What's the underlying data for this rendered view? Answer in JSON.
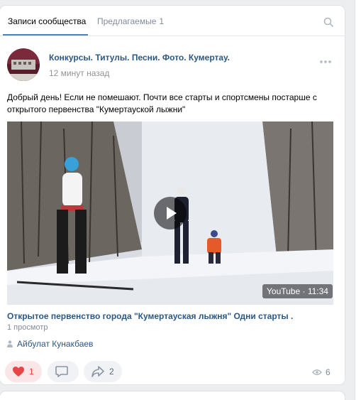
{
  "tabs": {
    "active_label": "Записи сообщества",
    "second_label": "Предлагаемые",
    "second_count": "1"
  },
  "post": {
    "author": "Конкурсы. Титулы. Песни. Фото. Кумертау.",
    "time": "12 минут назад",
    "text": "Добрый день! Если не помешают. Почти все старты и спортсмены постарше с открытого первенства \"Кумертауской лыжни\"",
    "video": {
      "duration": "YouTube · 11:34",
      "title": "Открытое первенство города \"Кумертауская лыжня\" Одни старты .",
      "views_line": "1 просмотр"
    },
    "signer": "Айбулат Кунакбаев",
    "actions": {
      "likes": "1",
      "shares": "2",
      "views": "6"
    }
  },
  "colors": {
    "link": "#2a5885",
    "accent": "#5181b8",
    "like_red": "#e64646",
    "muted": "#818c99"
  }
}
